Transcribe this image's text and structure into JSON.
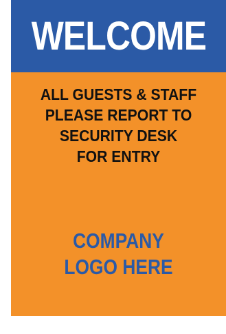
{
  "sign": {
    "banner": {
      "title": "WELCOME"
    },
    "notice": {
      "lines": [
        "ALL GUESTS & STAFF",
        "PLEASE REPORT TO",
        "SECURITY DESK",
        "FOR ENTRY"
      ]
    },
    "logo_placeholder": {
      "lines": [
        "COMPANY",
        "LOGO HERE"
      ]
    }
  },
  "colors": {
    "banner_blue": "#2b5aa6",
    "panel_orange": "#f39129",
    "notice_text": "#111111",
    "logo_text": "#2b5aa6"
  }
}
